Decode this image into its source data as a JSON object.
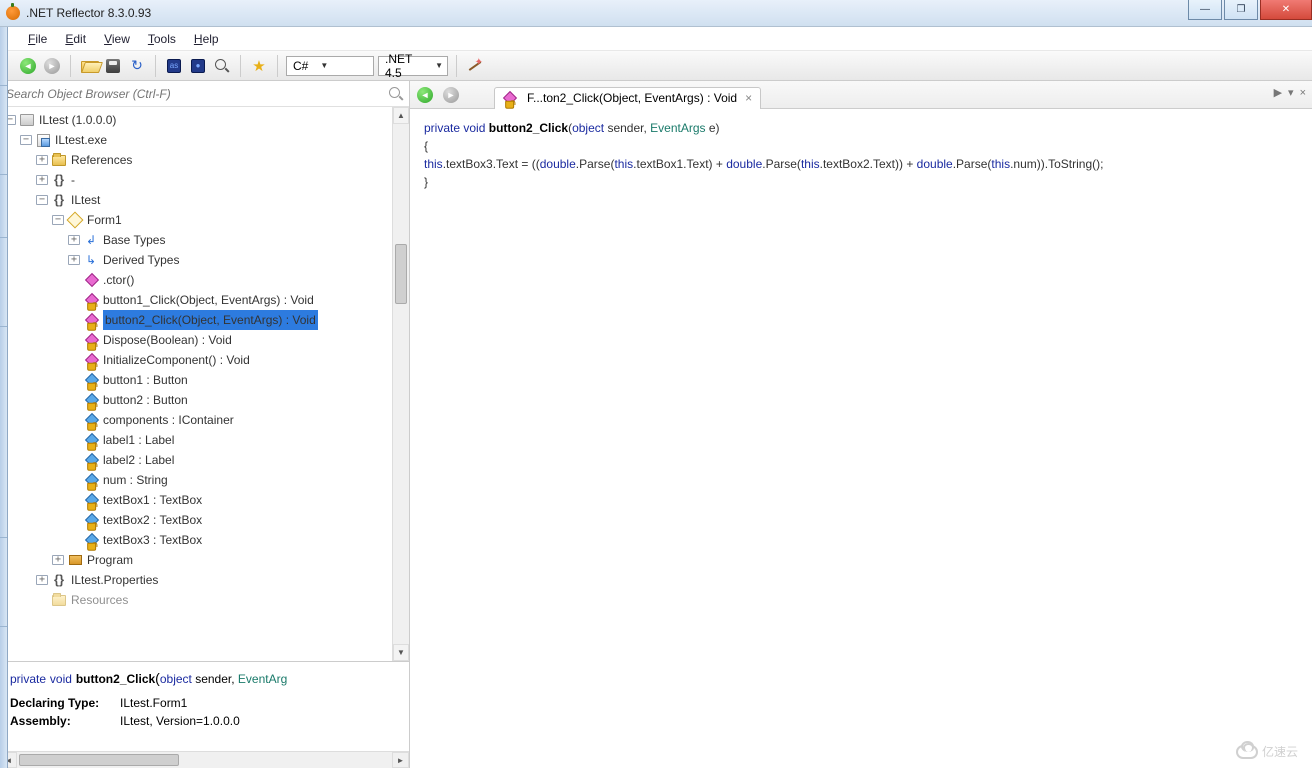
{
  "title": ".NET Reflector 8.3.0.93",
  "menu": {
    "file": "File",
    "edit": "Edit",
    "view": "View",
    "tools": "Tools",
    "help": "Help"
  },
  "toolbar": {
    "lang": "C#",
    "framework": ".NET 4.5"
  },
  "search": {
    "placeholder": "Search Object Browser (Ctrl-F)"
  },
  "tree": {
    "root": "ILtest (1.0.0.0)",
    "exe": "ILtest.exe",
    "refs": "References",
    "dash": "-",
    "ns": "ILtest",
    "form": "Form1",
    "baseTypes": "Base Types",
    "derivedTypes": "Derived Types",
    "ctor": ".ctor()",
    "btn1click": "button1_Click(Object, EventArgs) : Void",
    "btn2click": "button2_Click(Object, EventArgs) : Void",
    "dispose": "Dispose(Boolean) : Void",
    "initcomp": "InitializeComponent() : Void",
    "button1": "button1 : Button",
    "button2": "button2 : Button",
    "components": "components : IContainer",
    "label1": "label1 : Label",
    "label2": "label2 : Label",
    "num": "num : String",
    "tb1": "textBox1 : TextBox",
    "tb2": "textBox2 : TextBox",
    "tb3": "textBox3 : TextBox",
    "program": "Program",
    "props": "ILtest.Properties",
    "resources": "Resources"
  },
  "details": {
    "sig_private": "private",
    "sig_void": "void",
    "sig_name": "button2_Click",
    "sig_obj": "object",
    "sig_sender": " sender, ",
    "sig_ea": "EventArg",
    "declLabel": "Declaring Type:",
    "declVal": "ILtest.Form1",
    "asmLabel": "Assembly:",
    "asmVal": "ILtest, Version=1.0.0.0"
  },
  "tab": {
    "title": "F...ton2_Click(Object, EventArgs) : Void"
  },
  "code": {
    "l1a": "private",
    "l1b": "void",
    "l1c": "button2_Click",
    "l1d": "object",
    "l1e": " sender, ",
    "l1f": "EventArgs",
    "l1g": " e)",
    "l2": "{",
    "l3a": "    this",
    "l3b": ".textBox3.Text = ((",
    "l3c": "double",
    "l3d": ".Parse(",
    "l3e": "this",
    "l3f": ".textBox1.Text) + ",
    "l3g": "double",
    "l3h": ".Parse(",
    "l3i": "this",
    "l3j": ".textBox2.Text)) + ",
    "l3k": "double",
    "l3l": ".Parse(",
    "l3m": "this",
    "l3n": ".num)).ToString();",
    "l4": "}"
  },
  "watermark": "亿速云"
}
